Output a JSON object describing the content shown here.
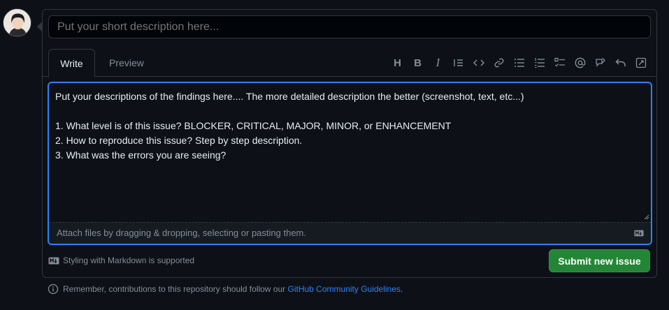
{
  "title_field": {
    "value": "",
    "placeholder": "Put your short description here..."
  },
  "tabs": [
    {
      "label": "Write",
      "active": true
    },
    {
      "label": "Preview",
      "active": false
    }
  ],
  "toolbar": {
    "icons": [
      "heading-icon",
      "bold-icon",
      "italic-icon",
      "quote-icon",
      "code-icon",
      "link-icon",
      "bulleted-list-icon",
      "numbered-list-icon",
      "task-list-icon",
      "mention-icon",
      "reference-icon",
      "undo-icon",
      "fullscreen-icon"
    ],
    "heading_glyph": "H",
    "bold_glyph": "B",
    "italic_glyph": "I"
  },
  "body_field": {
    "value": "Put your descriptions of the findings here.... The more detailed description the better (screenshot, text, etc...)\n\n1. What level is of this issue? BLOCKER, CRITICAL, MAJOR, MINOR, or ENHANCEMENT\n2. How to reproduce this issue? Step by step description.\n3. What was the errors you are seeing?"
  },
  "attach_hint": "Attach files by dragging & dropping, selecting or pasting them.",
  "markdown_note": "Styling with Markdown is supported",
  "submit_label": "Submit new issue",
  "notice": {
    "prefix": "Remember, contributions to this repository should follow our ",
    "link": "GitHub Community Guidelines",
    "suffix": "."
  },
  "colors": {
    "background": "#0d1117",
    "accent": "#2f81f7",
    "submit": "#238636",
    "muted": "#848d97"
  }
}
